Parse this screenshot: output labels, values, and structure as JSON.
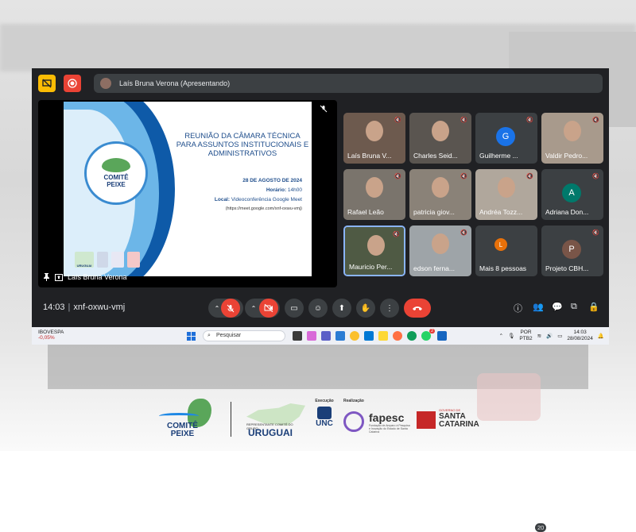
{
  "meeting": {
    "presenter_bar": "Laís Bruna Verona (Apresentando)",
    "stage_name": "Laís Bruna Verona",
    "time": "14:03",
    "code": "xnf-oxwu-vmj",
    "participant_count": "20"
  },
  "slide": {
    "title": "REUNIÃO DA CÂMARA TÉCNICA PARA ASSUNTOS INSTITUCIONAIS E ADMINISTRATIVOS",
    "date": "28 DE AGOSTO DE 2024",
    "time_label": "Horário:",
    "time_value": "14h00",
    "local_label": "Local:",
    "local_value": "Videoconferência Google Meet",
    "url": "(https://meet.google.com/xnf-oxwu-vmj)",
    "logo_line1": "COMITÊ",
    "logo_line2": "PEIXE",
    "footer_logo": "URUGUAI"
  },
  "tiles": [
    {
      "name": "Laís Bruna V...",
      "type": "photo"
    },
    {
      "name": "Charles Seid...",
      "type": "photo"
    },
    {
      "name": "Guilherme ...",
      "type": "avatar",
      "letter": "G",
      "color": "#1a73e8"
    },
    {
      "name": "Valdir Pedro...",
      "type": "photo"
    },
    {
      "name": "Rafael Leão",
      "type": "photo"
    },
    {
      "name": "patricia giov...",
      "type": "photo"
    },
    {
      "name": "Andréa Tozz...",
      "type": "photo"
    },
    {
      "name": "Adriana Don...",
      "type": "avatar",
      "letter": "A",
      "color": "#00796b"
    },
    {
      "name": "Mauricio Per...",
      "type": "photo"
    },
    {
      "name": "edson ferna...",
      "type": "photo"
    },
    {
      "name": "Mais 8 pessoas",
      "type": "more",
      "letter": "L"
    },
    {
      "name": "Projeto CBH...",
      "type": "avatar",
      "letter": "P",
      "color": "#795548"
    }
  ],
  "taskbar": {
    "stock_name": "IBOVESPA",
    "stock_change": "-0,05%",
    "search": "Pesquisar",
    "lang1": "POR",
    "lang2": "PTB2",
    "clock_time": "14:03",
    "clock_date": "28/08/2024",
    "badge_count": "2"
  },
  "footer": {
    "comite_line1": "COMITÊ",
    "comite_line2": "PEIXE",
    "uruguai_small": "REPRESENTANTE COMITÊ DO GRUPO",
    "uruguai": "URUGUAI",
    "execucao": "Execução",
    "unc": "UNC",
    "realizacao": "Realização",
    "fapesc": "fapesc",
    "fapesc_sub": "Fundação de Amparo à Pesquisa e Inovação do Estado de Santa Catarina",
    "gov_small": "GOVERNO DE",
    "santa": "SANTA",
    "catarina": "CATARINA"
  },
  "colors": {
    "meet_bg": "#202124",
    "tile_bg": "#3c4043",
    "end_call": "#ea4335",
    "accent_blue": "#1f4e8c"
  }
}
